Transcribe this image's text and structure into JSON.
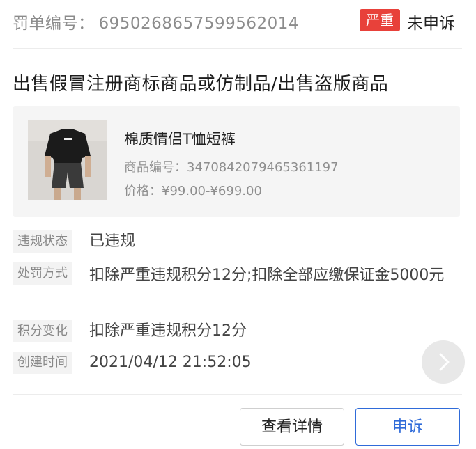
{
  "header": {
    "penalty_label": "罚单编号：",
    "penalty_number": "6950268657599562014",
    "severity_badge": "严重",
    "appeal_status": "未申诉"
  },
  "violation": {
    "title": "出售假冒注册商标商品或仿制品/出售盗版商品"
  },
  "product": {
    "name": "棉质情侣T恤短裤",
    "id_line": "商品编号：3470842079465361197",
    "price_line": "价格：¥99.00-¥699.00"
  },
  "details": [
    {
      "label": "违规状态",
      "value": "已违规"
    },
    {
      "label": "处罚方式",
      "value": "扣除严重违规积分12分;扣除全部应缴保证金5000元"
    },
    {
      "label": "积分变化",
      "value": "扣除严重违规积分12分"
    },
    {
      "label": "创建时间",
      "value": "2021/04/12 21:52:05"
    }
  ],
  "actions": {
    "view_details": "查看详情",
    "appeal": "申诉"
  },
  "colors": {
    "badge": "#e8413a",
    "primary": "#2f6bd9"
  },
  "icons": {
    "next": "chevron-right-icon"
  }
}
